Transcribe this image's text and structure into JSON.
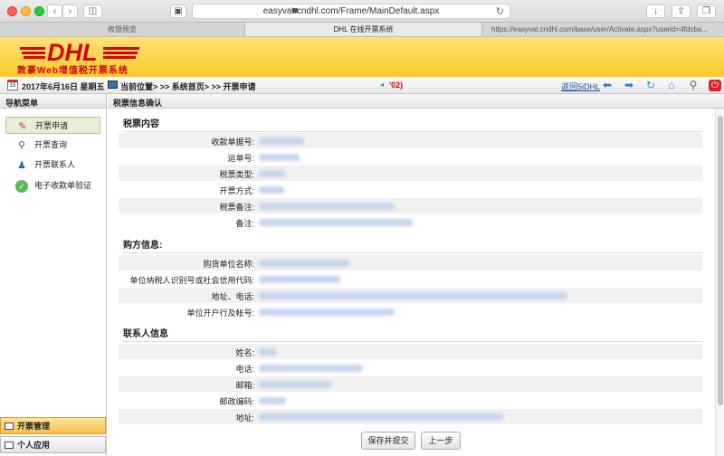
{
  "browser": {
    "url": "easyvat.cndhl.com/Frame/MainDefault.aspx",
    "tabs": [
      {
        "label": "收银预览"
      },
      {
        "label": "DHL 在线开票系统"
      },
      {
        "label": "https://easyvat.cndhl.com/base/user/Activate.aspx?userid=4fdcba..."
      }
    ]
  },
  "header": {
    "logo_text": "DHL",
    "logo_subtitle": "敦豪Web增值税开票系统"
  },
  "infobar": {
    "date": "2017年6月16日  星期五",
    "location": "当前位置>  >> 系统首页>  >> 开票申请",
    "marquee": "'02)",
    "back_link": "返回5iDHL"
  },
  "sidebar": {
    "title": "导航菜单",
    "items": [
      {
        "label": "开票申请",
        "icon": "pen-icon"
      },
      {
        "label": "开票查询",
        "icon": "magnifier-icon"
      },
      {
        "label": "开票联系人",
        "icon": "person-icon"
      },
      {
        "label": "电子收款单验证",
        "icon": "check-icon"
      }
    ],
    "bottom": [
      {
        "label": "开票管理"
      },
      {
        "label": "个人应用"
      }
    ]
  },
  "main": {
    "panel_title": "税票信息确认",
    "sections": [
      {
        "title": "税票内容",
        "fields": [
          "收款单据号:",
          "运单号:",
          "税票类型:",
          "开票方式:",
          "税票备注:",
          "备注:"
        ]
      },
      {
        "title": "购方信息:",
        "fields": [
          "购货单位名称:",
          "单位纳税人识别号或社会信用代码:",
          "地址、电话:",
          "单位开户行及帐号:"
        ]
      },
      {
        "title": "联系人信息",
        "fields": [
          "姓名:",
          "电话:",
          "邮箱:",
          "邮政编码:",
          "地址:"
        ]
      }
    ],
    "buttons": {
      "submit": "保存并提交",
      "back": "上一步"
    }
  },
  "colors": {
    "dhl_yellow": "#fcca2c",
    "dhl_red": "#d40511",
    "selected_bg": "#e6eed6"
  }
}
